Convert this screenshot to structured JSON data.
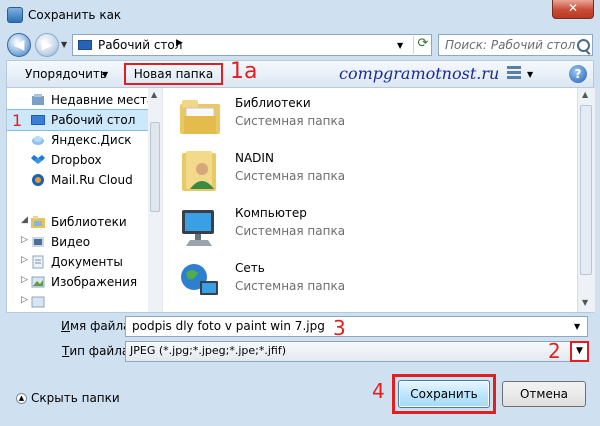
{
  "window": {
    "title": "Сохранить как",
    "close_label": "✕"
  },
  "navbar": {
    "back_glyph": "◀",
    "forward_glyph": "▶",
    "address_text": "Рабочий стол",
    "address_chevron": "▶",
    "search_placeholder": "Поиск: Рабочий стол"
  },
  "toolbar": {
    "organize_label": "Упорядочить",
    "new_folder_label": "Новая папка",
    "annotation_1a": "1а",
    "brand_text": "compgramotnost.ru",
    "help_label": "?"
  },
  "nav_pane": {
    "marker": "1",
    "items": [
      {
        "label": "Недавние места",
        "icon": "recent-places-icon"
      },
      {
        "label": "Рабочий стол",
        "icon": "desktop-icon",
        "selected": true
      },
      {
        "label": "Яндекс.Диск",
        "icon": "yandex-disk-icon"
      },
      {
        "label": "Dropbox",
        "icon": "dropbox-icon"
      },
      {
        "label": "Mail.Ru Cloud",
        "icon": "mailru-cloud-icon"
      },
      {
        "label": "Библиотеки",
        "icon": "libraries-icon"
      },
      {
        "label": "Видео",
        "icon": "video-library-icon"
      },
      {
        "label": "Документы",
        "icon": "documents-library-icon"
      },
      {
        "label": "Изображения",
        "icon": "images-library-icon"
      }
    ]
  },
  "files": [
    {
      "name": "Библиотеки",
      "type": "Системная папка",
      "icon": "libraries-folder-icon"
    },
    {
      "name": "NADIN",
      "type": "Системная папка",
      "icon": "user-folder-icon"
    },
    {
      "name": "Компьютер",
      "type": "Системная папка",
      "icon": "computer-icon"
    },
    {
      "name": "Сеть",
      "type": "Системная папка",
      "icon": "network-icon"
    }
  ],
  "fields": {
    "filename_label_u": "И",
    "filename_label_rest": "мя файла:",
    "filename_value": "podpis dly foto v paint win 7.jpg",
    "filetype_label_u": "Т",
    "filetype_label_rest": "ип файла:",
    "filetype_value": "JPEG (*.jpg;*.jpeg;*.jpe;*.jfif)",
    "marker_3": "3",
    "marker_2": "2"
  },
  "bottom": {
    "hide_folders_label": "Скрыть папки",
    "marker_4": "4",
    "save_label": "Сохранить",
    "cancel_label": "Отмена"
  },
  "colors": {
    "annotation_red": "#e02020",
    "brand_blue": "#1a2a9a",
    "selection": "#cde8fb"
  }
}
